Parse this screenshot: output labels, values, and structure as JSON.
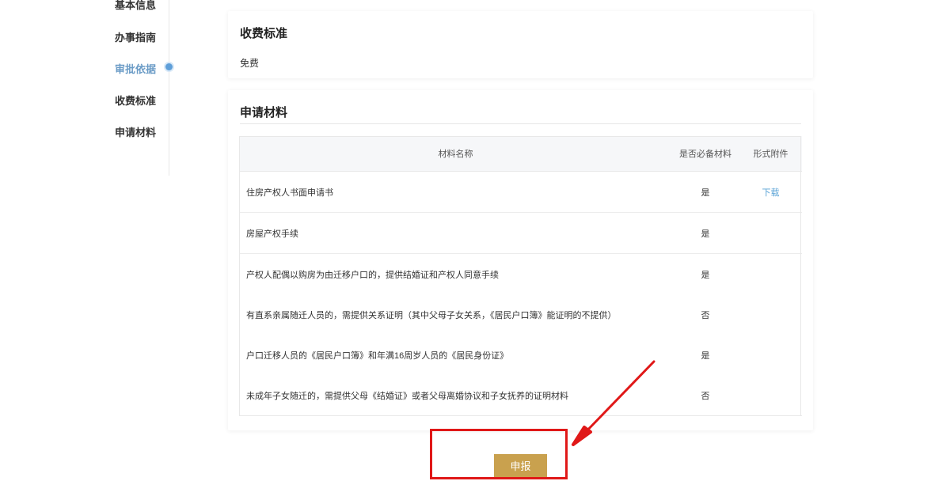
{
  "sidebar": {
    "items": [
      {
        "label": "基本信息"
      },
      {
        "label": "办事指南"
      },
      {
        "label": "审批依据"
      },
      {
        "label": "收费标准"
      },
      {
        "label": "申请材料"
      }
    ]
  },
  "fee_section": {
    "title": "收费标准",
    "text": "免费"
  },
  "materials_section": {
    "title": "申请材料",
    "headers": {
      "name": "材料名称",
      "required": "是否必备材料",
      "attachment": "形式附件"
    },
    "rows": [
      {
        "name": "住房产权人书面申请书",
        "required": "是",
        "attachment": "下载"
      },
      {
        "name": "房屋产权手续",
        "required": "是",
        "attachment": ""
      },
      {
        "name": "产权人配偶以购房为由迁移户口的，提供结婚证和产权人同意手续",
        "required": "是",
        "attachment": ""
      },
      {
        "name": "有直系亲属随迁人员的，需提供关系证明（其中父母子女关系，《居民户口簿》能证明的不提供）",
        "required": "否",
        "attachment": ""
      },
      {
        "name": "户口迁移人员的《居民户口簿》和年满16周岁人员的《居民身份证》",
        "required": "是",
        "attachment": ""
      },
      {
        "name": "未成年子女随迁的，需提供父母《结婚证》或者父母离婚协议和子女抚养的证明材料",
        "required": "否",
        "attachment": ""
      }
    ]
  },
  "submit": {
    "label": "申报"
  },
  "colors": {
    "accent": "#c9a14e",
    "active_nav": "#6a9bc6",
    "annotation": "#e01818"
  }
}
